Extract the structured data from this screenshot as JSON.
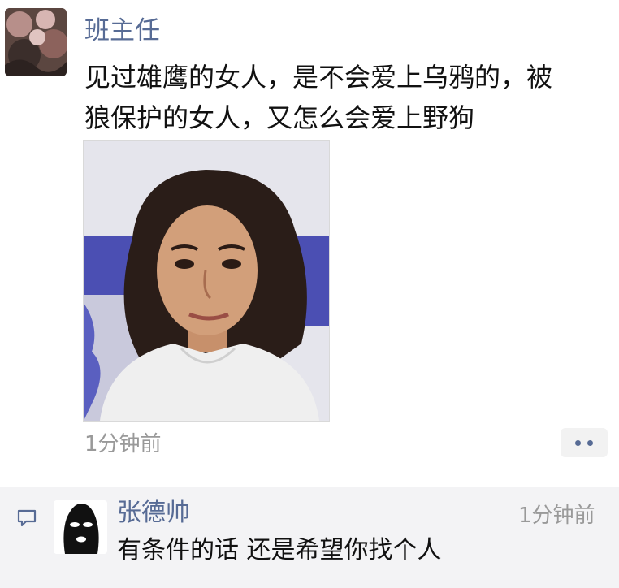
{
  "post": {
    "author": "班主任",
    "text_lines": [
      "见过雄鹰的女人，是不会爱上乌鸦的，被",
      "狼保护的女人，又怎么会爱上野狗"
    ],
    "time": "1分钟前",
    "more_icon": "ellipsis-icon"
  },
  "comment": {
    "icon": "comment-bubble-icon",
    "author": "张德帅",
    "time": "1分钟前",
    "text": "有条件的话 还是希望你找个人"
  },
  "colors": {
    "name_link": "#576b95",
    "meta_gray": "#999999",
    "comment_bg": "#f3f3f5"
  }
}
